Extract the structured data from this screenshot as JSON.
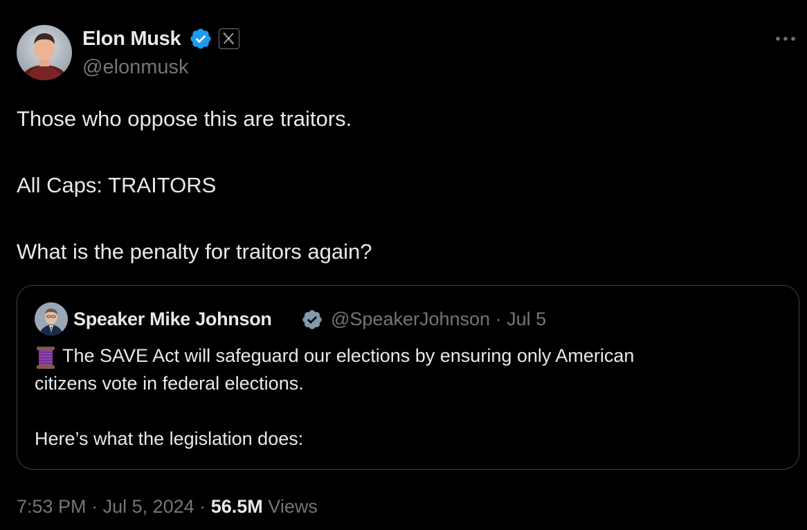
{
  "author": {
    "name": "Elon Musk",
    "handle": "@elonmusk",
    "verified_color": "#1d9bf0",
    "affiliate_badge": "x-logo-icon"
  },
  "tweet": {
    "lines": [
      "Those who oppose this are traitors.",
      "All Caps: TRAITORS",
      "What is the penalty for traitors again?"
    ]
  },
  "quoted": {
    "name": "Speaker Mike Johnson",
    "handle": "@SpeakerJohnson",
    "separator": "·",
    "date": "Jul 5",
    "verified_color": "#829aab",
    "icon": "thread-spool-icon",
    "lines": [
      "The SAVE Act will safeguard our elections by ensuring only American",
      "citizens vote in federal elections.",
      "Here’s what the legislation does:"
    ]
  },
  "footer": {
    "time": "7:53 PM",
    "separator": "·",
    "date": "Jul 5, 2024",
    "views_count": "56.5M",
    "views_label": "Views"
  },
  "colors": {
    "background": "#000000",
    "text": "#e7e9ea",
    "secondary": "#71767b",
    "border": "#3f4448"
  }
}
